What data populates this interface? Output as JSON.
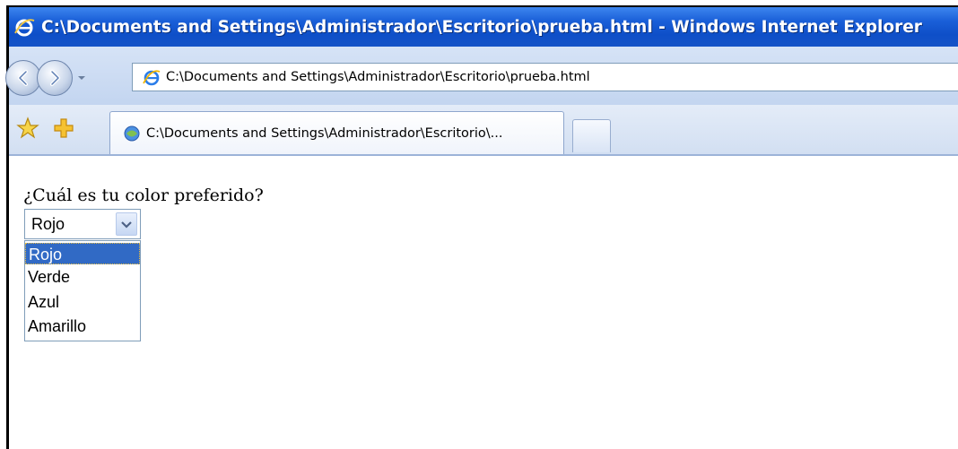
{
  "window": {
    "title": "C:\\Documents and Settings\\Administrador\\Escritorio\\prueba.html - Windows Internet Explorer",
    "colors": {
      "titlebar": "#1a5fd8",
      "selection": "#316ac5"
    }
  },
  "address_bar": {
    "url": "C:\\Documents and Settings\\Administrador\\Escritorio\\prueba.html",
    "icons": [
      "back-arrow-icon",
      "forward-arrow-icon",
      "chevron-down-icon",
      "ie-logo-icon"
    ]
  },
  "tabs": [
    {
      "label": "C:\\Documents and Settings\\Administrador\\Escritorio\\...",
      "icon": "ie-page-icon"
    }
  ],
  "toolbar_icons": [
    "favorites-star-icon",
    "add-favorite-icon"
  ],
  "page": {
    "question": "¿Cuál es tu color preferido?",
    "select": {
      "value": "Rojo",
      "options": [
        "Rojo",
        "Verde",
        "Azul",
        "Amarillo"
      ],
      "highlighted": "Rojo"
    }
  }
}
